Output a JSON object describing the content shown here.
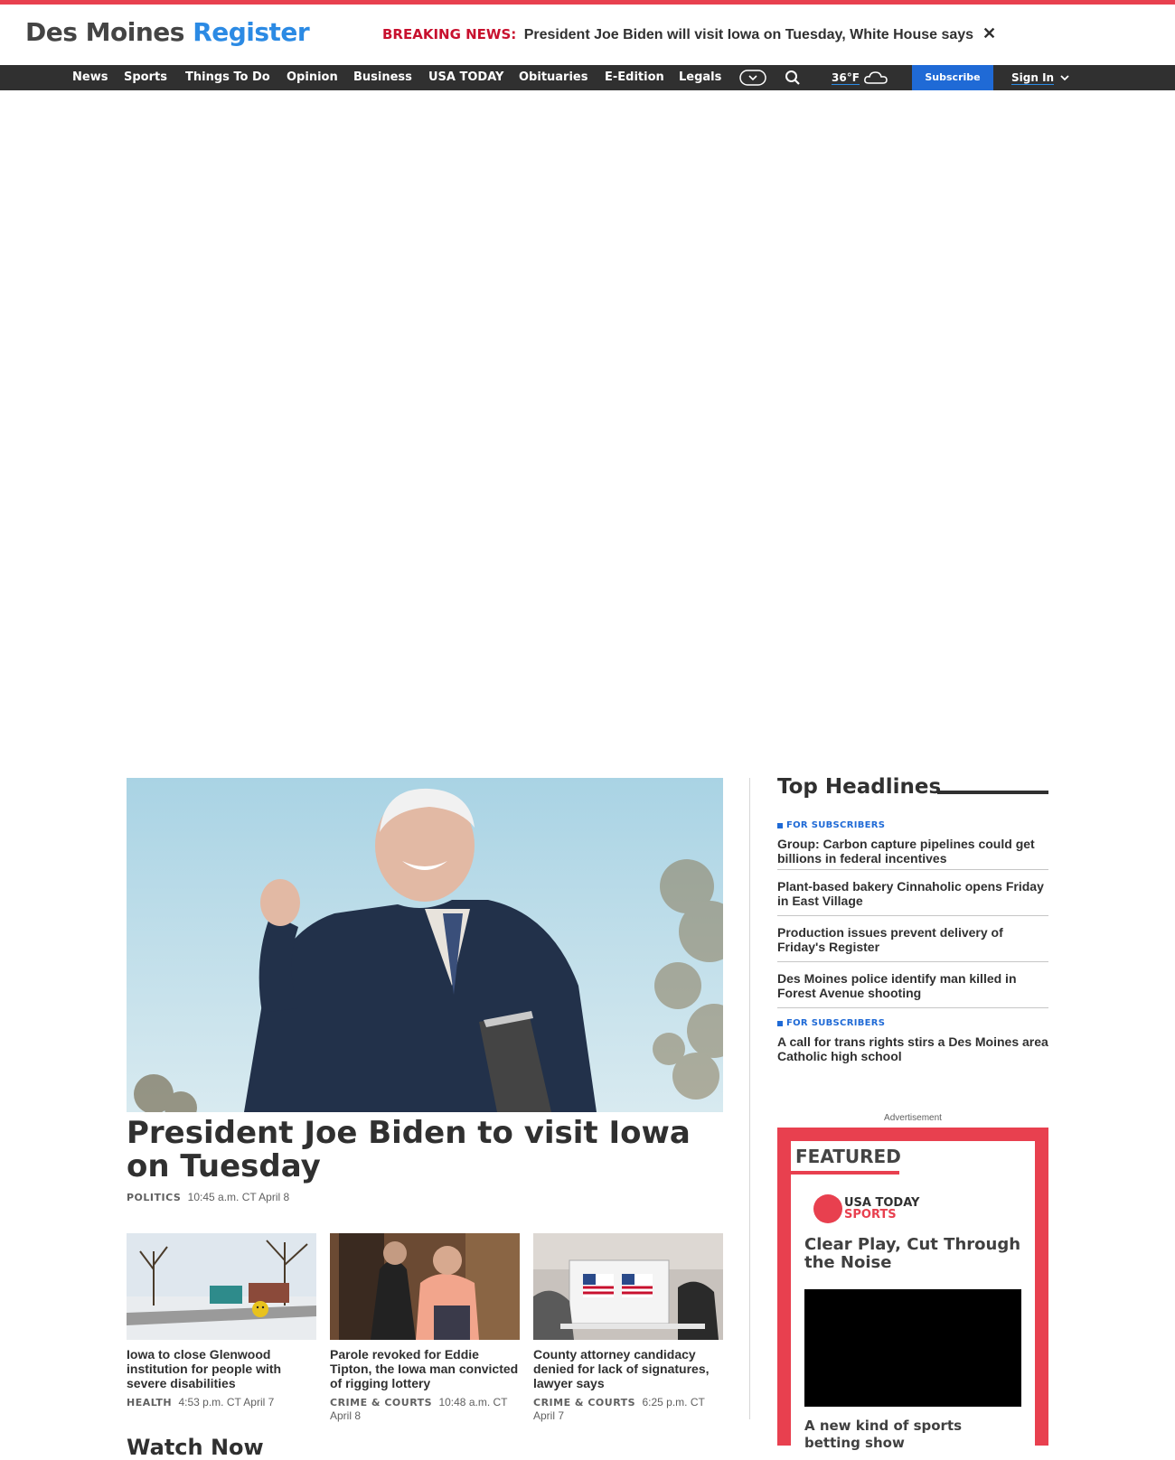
{
  "brand": {
    "part1": "Des Moines",
    "part2": "Register",
    "accent": "#2b8ae4",
    "topline": "#e8404f"
  },
  "breaking": {
    "tag": "BREAKING NEWS:",
    "headline": "President Joe Biden will visit Iowa on Tuesday, White House says",
    "close": "✕"
  },
  "nav": {
    "items": [
      "News",
      "Sports",
      "Things To Do",
      "Opinion",
      "Business",
      "USA TODAY",
      "Obituaries",
      "E-Edition",
      "Legals"
    ],
    "weather": "36°F",
    "subscribe": "Subscribe",
    "signin": "Sign In"
  },
  "hero": {
    "title": "President Joe Biden to visit Iowa on Tuesday",
    "category": "POLITICS",
    "time": "10:45 a.m. CT April 8"
  },
  "cards": [
    {
      "title": "Iowa to close Glenwood institution for people with severe disabilities",
      "category": "HEALTH",
      "time": "4:53 p.m. CT April 7"
    },
    {
      "title": "Parole revoked for Eddie Tipton, the Iowa man convicted of rigging lottery",
      "category": "CRIME & COURTS",
      "time": "10:48 a.m. CT April 8"
    },
    {
      "title": "County attorney candidacy denied for lack of signatures, lawyer says",
      "category": "CRIME & COURTS",
      "time": "6:25 p.m. CT April 7"
    }
  ],
  "watch": {
    "title": "Watch Now"
  },
  "sidebar": {
    "heading": "Top Headlines",
    "subscriber_tag": "FOR SUBSCRIBERS",
    "items": [
      {
        "title": "Group: Carbon capture pipelines could get billions in federal incentives",
        "subscriber": true
      },
      {
        "title": "Plant-based bakery Cinnaholic opens Friday in East Village",
        "subscriber": false
      },
      {
        "title": "Production issues prevent delivery of Friday's Register",
        "subscriber": false
      },
      {
        "title": "Des Moines police identify man killed in Forest Avenue shooting",
        "subscriber": false
      },
      {
        "title": "A call for trans rights stirs a Des Moines area Catholic high school",
        "subscriber": true
      }
    ]
  },
  "ad": {
    "label": "Advertisement",
    "featured": "FEATURED",
    "brand_a": "USA TODAY",
    "brand_b": "SPORTS",
    "title": "Clear Play, Cut Through the Noise",
    "subtitle": "A new kind of sports betting show"
  }
}
